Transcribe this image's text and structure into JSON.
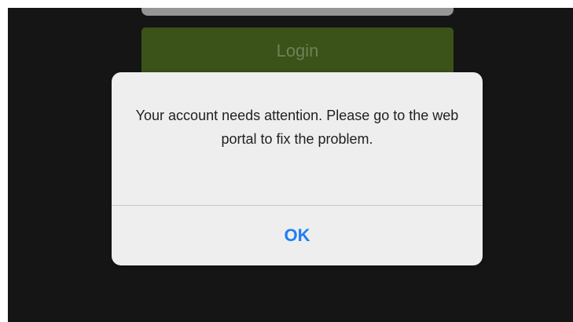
{
  "login_form": {
    "login_button_label": "Login"
  },
  "alert": {
    "message": "Your account needs attention. Please go to the web portal to fix the problem.",
    "ok_label": "OK"
  },
  "colors": {
    "background": "#1c1c1c",
    "login_button": "#4f6e21",
    "ok_text": "#1e7ef5"
  }
}
